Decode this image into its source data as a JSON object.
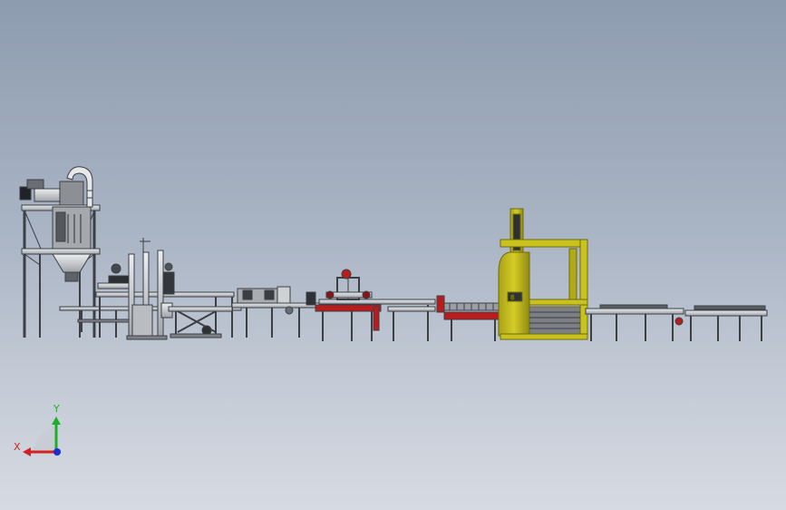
{
  "viewport": {
    "background_top": "#8e9cb0",
    "background_bottom": "#d6dae2"
  },
  "triad": {
    "x_label": "X",
    "y_label": "Y",
    "x_color": "#d42020",
    "y_color": "#1fae2a",
    "z_color": "#1a2fd0"
  },
  "colors": {
    "steel": "#d8dadc",
    "steel_dark": "#3c3f44",
    "frame_yellow": "#c9c21c",
    "frame_yellow_dark": "#6e6a10",
    "conveyor_red": "#b81c1c",
    "belt_gray": "#9a9ea4"
  },
  "icons": {
    "triad": "coordinate-triad-icon"
  }
}
